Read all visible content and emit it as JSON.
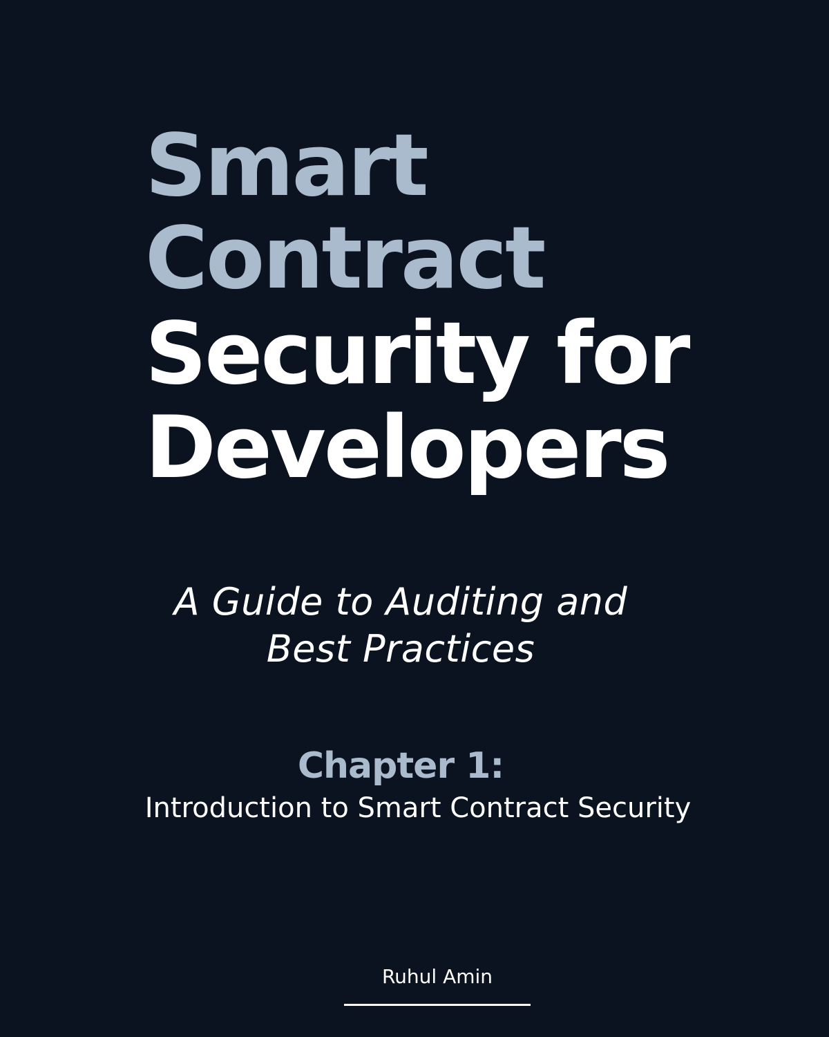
{
  "title": {
    "line1": "Smart",
    "line2": "Contract",
    "line3": "Security for",
    "line4": "Developers"
  },
  "subtitle": {
    "line1": "A Guide to Auditing and",
    "line2": "Best Practices"
  },
  "chapter": {
    "number": "Chapter 1:",
    "title": "Introduction to Smart Contract Security"
  },
  "author": "Ruhul Amin",
  "colors": {
    "background": "#0c1320",
    "accent": "#a9bbcc",
    "text": "#ffffff"
  }
}
